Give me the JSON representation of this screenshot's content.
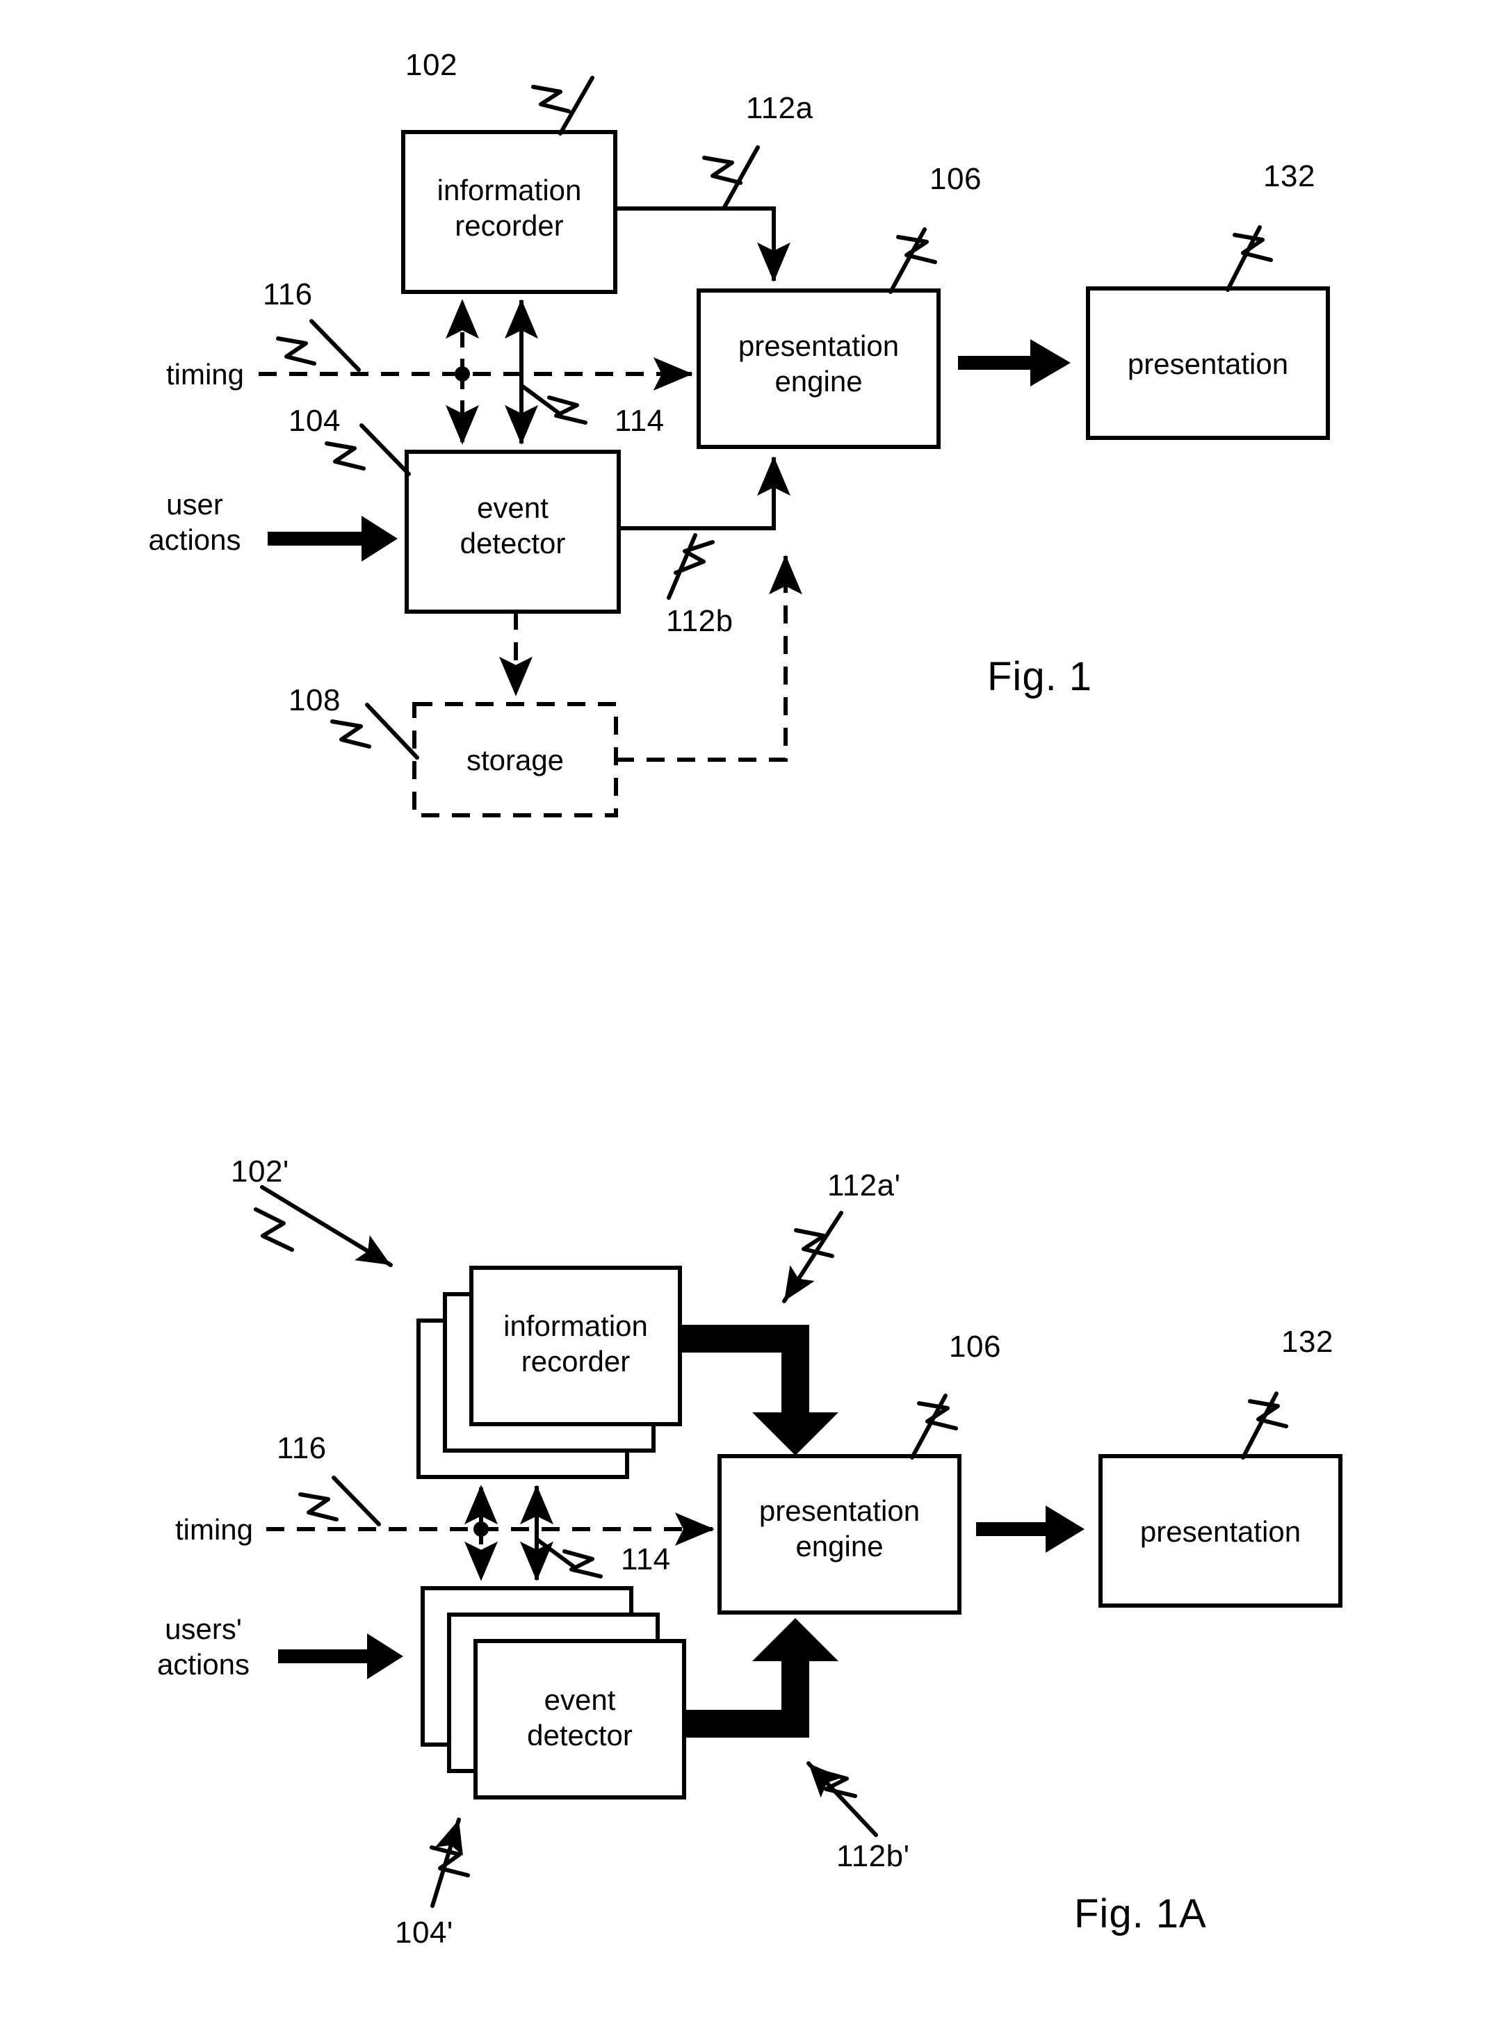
{
  "figures": [
    {
      "id": "fig1",
      "caption": "Fig. 1",
      "blocks": {
        "information_recorder": "information\nrecorder",
        "information_recorder_line1": "information",
        "information_recorder_line2": "recorder",
        "event_detector_line1": "event",
        "event_detector_line2": "detector",
        "presentation_engine_line1": "presentation",
        "presentation_engine_line2": "engine",
        "presentation": "presentation",
        "storage": "storage"
      },
      "io_labels": {
        "timing": "timing",
        "user_actions_line1": "user",
        "user_actions_line2": "actions"
      },
      "reference_numerals": {
        "information_recorder": "102",
        "event_detector": "104",
        "presentation_engine": "106",
        "storage": "108",
        "recorder_to_engine": "112a",
        "detector_to_engine": "112b",
        "sync_bus": "114",
        "timing": "116",
        "presentation": "132"
      }
    },
    {
      "id": "fig1a",
      "caption": "Fig. 1A",
      "blocks": {
        "information_recorder_line1": "information",
        "information_recorder_line2": "recorder",
        "event_detector_line1": "event",
        "event_detector_line2": "detector",
        "presentation_engine_line1": "presentation",
        "presentation_engine_line2": "engine",
        "presentation": "presentation"
      },
      "io_labels": {
        "timing": "timing",
        "users_actions_line1": "users'",
        "users_actions_line2": "actions"
      },
      "reference_numerals": {
        "information_recorders": "102'",
        "event_detectors": "104'",
        "presentation_engine": "106",
        "recorders_to_engine": "112a'",
        "detectors_to_engine": "112b'",
        "sync_bus": "114",
        "timing": "116",
        "presentation": "132"
      }
    }
  ],
  "style": {
    "ink": "#000000",
    "paper": "#ffffff"
  }
}
